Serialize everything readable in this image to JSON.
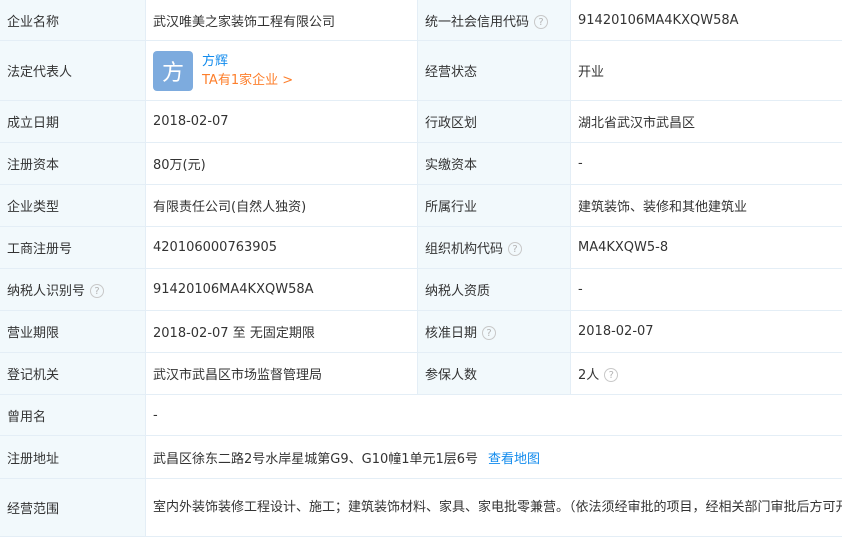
{
  "rows": {
    "company_name": {
      "label": "企业名称",
      "value": "武汉唯美之家装饰工程有限公司"
    },
    "credit_code": {
      "label": "统一社会信用代码",
      "value": "91420106MA4KXQW58A"
    },
    "legal_rep": {
      "label": "法定代表人",
      "avatar_char": "方",
      "name": "方辉",
      "companies_link": "TA有1家企业 >"
    },
    "status": {
      "label": "经营状态",
      "value": "开业"
    },
    "established": {
      "label": "成立日期",
      "value": "2018-02-07"
    },
    "region": {
      "label": "行政区划",
      "value": "湖北省武汉市武昌区"
    },
    "reg_capital": {
      "label": "注册资本",
      "value": "80万(元)"
    },
    "paid_capital": {
      "label": "实缴资本",
      "value": "-"
    },
    "company_type": {
      "label": "企业类型",
      "value": "有限责任公司(自然人独资)"
    },
    "industry": {
      "label": "所属行业",
      "value": "建筑装饰、装修和其他建筑业"
    },
    "reg_number": {
      "label": "工商注册号",
      "value": "420106000763905"
    },
    "org_code": {
      "label": "组织机构代码",
      "value": "MA4KXQW5-8"
    },
    "taxpayer_id": {
      "label": "纳税人识别号",
      "value": "91420106MA4KXQW58A"
    },
    "taxpayer_qual": {
      "label": "纳税人资质",
      "value": "-"
    },
    "business_term": {
      "label": "营业期限",
      "value": "2018-02-07 至 无固定期限"
    },
    "approval_date": {
      "label": "核准日期",
      "value": "2018-02-07"
    },
    "authority": {
      "label": "登记机关",
      "value": "武汉市武昌区市场监督管理局"
    },
    "insured": {
      "label": "参保人数",
      "value": "2人"
    },
    "former_name": {
      "label": "曾用名",
      "value": "-"
    },
    "address": {
      "label": "注册地址",
      "value": "武昌区徐东二路2号水岸星城第G9、G10幢1单元1层6号",
      "map_link": "查看地图"
    },
    "scope": {
      "label": "经营范围",
      "value": "室内外装饰装修工程设计、施工；建筑装饰材料、家具、家电批零兼营。（依法须经审批的项目，经相关部门审批后方可开展经营活动）"
    }
  },
  "help_glyph": "?",
  "colors": {
    "label_bg": "#f2f9fc",
    "border": "#e4eef6",
    "link_blue": "#128bed",
    "link_orange": "#fd7f2c",
    "avatar_bg": "#7dabde"
  },
  "icons": {
    "help": "question-circle-icon"
  }
}
